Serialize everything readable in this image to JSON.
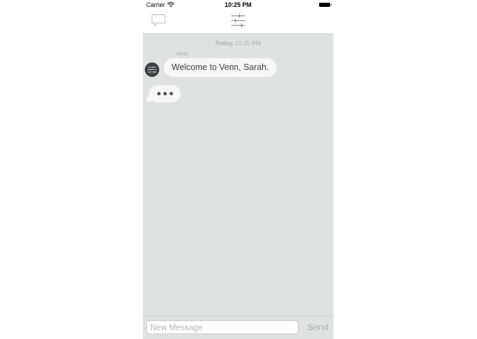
{
  "status_bar": {
    "carrier": "Carrier",
    "time": "10:25 PM",
    "icons": [
      "wifi-icon",
      "battery-icon"
    ]
  },
  "nav_bar": {
    "left_icon": "chat-bubble-icon",
    "center_icon": "settings-sliders-icon"
  },
  "chat": {
    "timestamp_day": "Today",
    "timestamp_time": "10:25 PM",
    "messages": [
      {
        "sender": "Venn",
        "text": "Welcome to Venn, Sarah."
      }
    ],
    "typing_indicator": "•••"
  },
  "input": {
    "placeholder": "New Message",
    "value": "",
    "send_label": "Send"
  },
  "colors": {
    "chat_background": "#dfe2e3",
    "bubble": "#f7f7f7",
    "avatar": "#3b3f42",
    "muted_text": "#aeb2b4"
  }
}
